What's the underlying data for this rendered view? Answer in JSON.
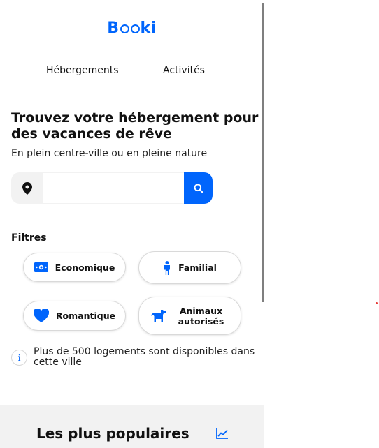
{
  "brand": {
    "logo_text_a": "B",
    "logo_text_b": "ki",
    "logo_full": "Booki",
    "color": "#0065FC"
  },
  "nav": {
    "items": [
      {
        "label": "Hébergements"
      },
      {
        "label": "Activités"
      }
    ]
  },
  "hero": {
    "title": "Trouvez votre hébergement pour des vacances de rêve",
    "subtitle": "En plein centre-ville ou en pleine nature"
  },
  "search": {
    "value": "",
    "placeholder": "",
    "location_icon": "map-pin-icon",
    "button_icon": "search-icon"
  },
  "filters": {
    "title": "Filtres",
    "items": [
      {
        "label": "Economique",
        "icon": "money-icon"
      },
      {
        "label": "Familial",
        "icon": "person-icon"
      },
      {
        "label": "Romantique",
        "icon": "heart-icon"
      },
      {
        "label": "Animaux autorisés",
        "icon": "dog-icon"
      }
    ]
  },
  "info": {
    "icon": "info-icon",
    "glyph": "i",
    "text": "Plus de 500 logements sont disponibles dans cette ville"
  },
  "popular": {
    "title": "Les plus populaires",
    "icon": "trend-chart-icon"
  },
  "colors": {
    "accent": "#0065FC",
    "section_bg": "#f2f2f2"
  }
}
